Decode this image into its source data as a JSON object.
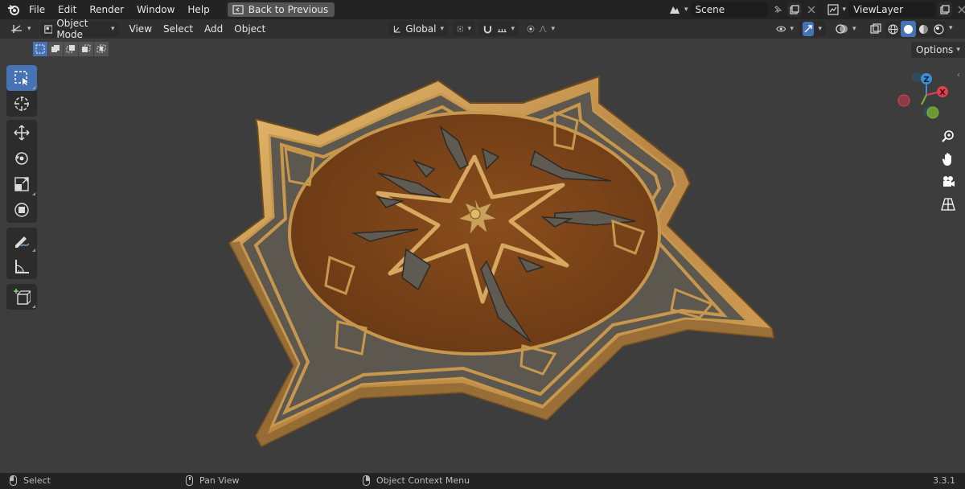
{
  "topbar": {
    "menus": [
      "File",
      "Edit",
      "Render",
      "Window",
      "Help"
    ],
    "back_button": "Back to Previous",
    "scene_name": "Scene",
    "view_layer": "ViewLayer"
  },
  "header": {
    "mode": "Object Mode",
    "menus": [
      "View",
      "Select",
      "Add",
      "Object"
    ],
    "transform_orientation": "Global"
  },
  "options_label": "Options",
  "statusbar": {
    "items": [
      "Select",
      "Pan View",
      "Object Context Menu"
    ],
    "version": "3.3.1"
  },
  "colors": {
    "accent": "#4772b3",
    "viewport_bg": "#3d3d3d",
    "axis_x": "#e0404f",
    "axis_y": "#7fb33a",
    "axis_z": "#3b8fd8",
    "wood": "#7a4418",
    "gold": "#c7974e",
    "metal": "#5f5a52"
  }
}
